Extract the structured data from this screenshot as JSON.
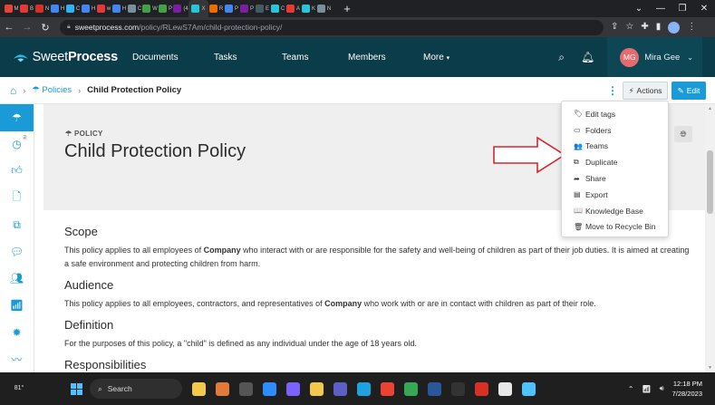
{
  "browser": {
    "tabs": [
      {
        "letter": "M",
        "color": "#ea4335"
      },
      {
        "letter": "B",
        "color": "#e53935"
      },
      {
        "letter": "N",
        "color": "#d93025"
      },
      {
        "letter": "H",
        "color": "#4285f4"
      },
      {
        "letter": "C",
        "color": "#29b6f6"
      },
      {
        "letter": "H",
        "color": "#4285f4"
      },
      {
        "letter": "w",
        "color": "#e53935"
      },
      {
        "letter": "H",
        "color": "#4285f4"
      },
      {
        "letter": "C",
        "color": "#78909c"
      },
      {
        "letter": "W",
        "color": "#43a047"
      },
      {
        "letter": "P",
        "color": "#43a047"
      },
      {
        "letter": "(4",
        "color": "#7b1fa2"
      },
      {
        "letter": "X",
        "color": "#26c6da",
        "active": true
      },
      {
        "letter": "R",
        "color": "#ef6c00"
      },
      {
        "letter": "P",
        "color": "#4285f4"
      },
      {
        "letter": "P",
        "color": "#7b1fa2"
      },
      {
        "letter": "E",
        "color": "#455a64"
      },
      {
        "letter": "C",
        "color": "#26c6da"
      },
      {
        "letter": "A",
        "color": "#e53935"
      },
      {
        "letter": "K",
        "color": "#26c6da"
      },
      {
        "letter": "N",
        "color": "#78909c"
      }
    ],
    "new_tab": "+",
    "window_controls": [
      "⌄",
      "—",
      "❐",
      "✕"
    ],
    "url_host": "sweetprocess.com",
    "url_path": "/policy/RLewS7Am/child-protection-policy/"
  },
  "app": {
    "brand_prefix": "Sweet",
    "brand_suffix": "Process",
    "brand_color": "#0b3c49",
    "accent_color": "#1a9ad6",
    "menu": [
      "Documents",
      "Tasks",
      "Teams",
      "Members",
      "More"
    ],
    "user_initials": "MG",
    "user_name": "Mira Gee"
  },
  "breadcrumb": {
    "section": "Policies",
    "current": "Child Protection Policy"
  },
  "toolbar": {
    "actions_label": "Actions",
    "edit_label": "Edit"
  },
  "sidebar": {
    "items": [
      "policy-icon",
      "clock-icon",
      "thumbs-up-icon",
      "document-icon",
      "copy-icon",
      "chat-icon",
      "team-icon",
      "chart-icon",
      "gear-icon",
      "pulse-icon"
    ],
    "badge": "2"
  },
  "document": {
    "kicker": "POLICY",
    "title": "Child Protection Policy",
    "sections": [
      {
        "heading": "Scope",
        "text_before": "This policy applies to all employees of ",
        "bold": "Company",
        "text_after": " who interact with or are responsible for the safety and well-being of children as part of their job duties. It is aimed at creating a safe environment and protecting children from harm."
      },
      {
        "heading": "Audience",
        "text_before": "This policy applies to all employees, contractors, and representatives of ",
        "bold": "Company",
        "text_after": " who work with or are in contact with children as part of their role."
      },
      {
        "heading": "Definition",
        "text_before": "For the purposes of this policy, a \"child\" is defined as any individual under the age of 18 years old.",
        "bold": "",
        "text_after": ""
      },
      {
        "heading": "Responsibilities",
        "text_before": "",
        "bold": "",
        "text_after": ""
      }
    ]
  },
  "actions_menu": [
    {
      "icon": "tag-icon",
      "glyph": "🏷",
      "label": "Edit tags"
    },
    {
      "icon": "folder-icon",
      "glyph": "▭",
      "label": "Folders"
    },
    {
      "icon": "users-icon",
      "glyph": "👥",
      "label": "Teams"
    },
    {
      "icon": "duplicate-icon",
      "glyph": "⧉",
      "label": "Duplicate"
    },
    {
      "icon": "share-icon",
      "glyph": "➦",
      "label": "Share"
    },
    {
      "icon": "export-icon",
      "glyph": "▤",
      "label": "Export"
    },
    {
      "icon": "book-icon",
      "glyph": "📖",
      "label": "Knowledge Base"
    },
    {
      "icon": "trash-icon",
      "glyph": "🗑",
      "label": "Move to Recycle Bin"
    }
  ],
  "taskbar": {
    "temperature": "81°",
    "search_label": "Search",
    "apps": [
      {
        "name": "file-explorer-icon",
        "color": "#f2c94c"
      },
      {
        "name": "widgets-icon",
        "color": "#e07b39"
      },
      {
        "name": "task-view-icon",
        "color": "#555555"
      },
      {
        "name": "zoom-icon",
        "color": "#2d8cff"
      },
      {
        "name": "video-icon",
        "color": "#7b61ff"
      },
      {
        "name": "folder-icon",
        "color": "#f2c94c"
      },
      {
        "name": "teams-icon",
        "color": "#5b5fc7"
      },
      {
        "name": "edge-icon",
        "color": "#1fa2e0"
      },
      {
        "name": "chrome-icon",
        "color": "#ea4335"
      },
      {
        "name": "maps-icon",
        "color": "#34a853"
      },
      {
        "name": "word-icon",
        "color": "#2b579a"
      },
      {
        "name": "app-icon",
        "color": "#333333"
      },
      {
        "name": "pdf-icon",
        "color": "#d93025"
      },
      {
        "name": "notes-icon",
        "color": "#e8e8e8"
      },
      {
        "name": "paint-icon",
        "color": "#4cc2ff"
      }
    ],
    "time": "12:18 PM",
    "date": "7/28/2023"
  }
}
